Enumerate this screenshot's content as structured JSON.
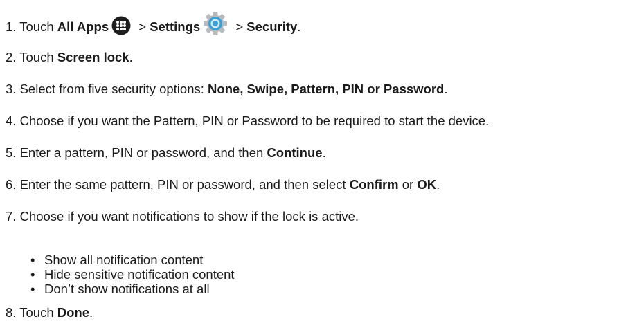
{
  "steps": [
    {
      "num": "1.",
      "t1": "Touch ",
      "b1": "All Apps",
      "apps_icon": "apps-grid-icon",
      "t2": " > ",
      "b2": "Settings",
      "settings_icon": "settings-gear-icon",
      "t3": " > ",
      "b3": "Security",
      "t4": "."
    },
    {
      "num": "2.",
      "t1": "Touch ",
      "b1": "Screen lock",
      "t2": "."
    },
    {
      "num": "3.",
      "t1": "Select from five security options: ",
      "b1": "None, Swipe, Pattern, PIN or Password",
      "t2": "."
    },
    {
      "num": "4.",
      "t1": "Choose if you want the Pattern, PIN or Password to be required to start the device."
    },
    {
      "num": "5.",
      "t1": "Enter a pattern, PIN or password, and then ",
      "b1": "Continue",
      "t2": "."
    },
    {
      "num": "6.",
      "t1": "Enter the same pattern, PIN or password, and then select ",
      "b1": "Confirm",
      "t2": " or ",
      "b2": "OK",
      "t3": "."
    },
    {
      "num": "7.",
      "t1": "Choose if you want notifications to show if the lock is active."
    },
    {
      "num": "8.",
      "t1": "Touch ",
      "b1": "Done",
      "t2": "."
    }
  ],
  "bullets": [
    "Show all notification content",
    "Hide sensitive notification content",
    "Don’t show notifications at all"
  ],
  "bullet_char": "•",
  "colors": {
    "text": "#1a1a1a",
    "apps_icon_bg": "#1e1e1e",
    "gear_blue": "#39a0d6",
    "gear_grey": "#b9bcbf"
  }
}
